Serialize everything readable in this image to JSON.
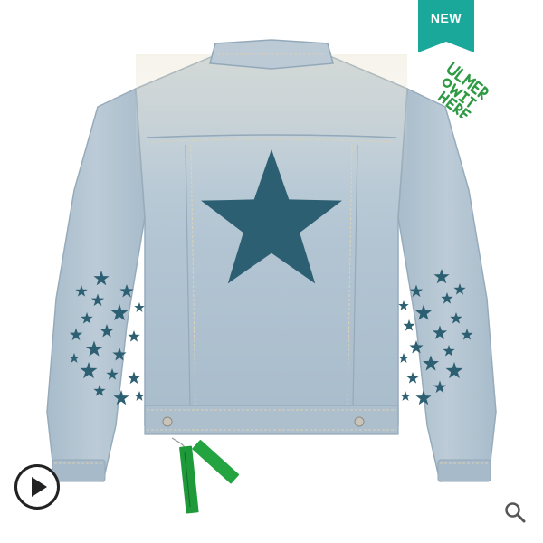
{
  "badge": {
    "label": "NEW",
    "color": "#1aa89a"
  },
  "sticker": {
    "color": "#2f9a44"
  },
  "product": {
    "type": "denim jacket",
    "denim_color": "#b4c6d4",
    "star_color": "#2d5f72",
    "tag_color": "#1f9a3a"
  },
  "controls": {
    "play_icon": "play-circle-icon",
    "zoom_icon": "magnifier-icon"
  }
}
